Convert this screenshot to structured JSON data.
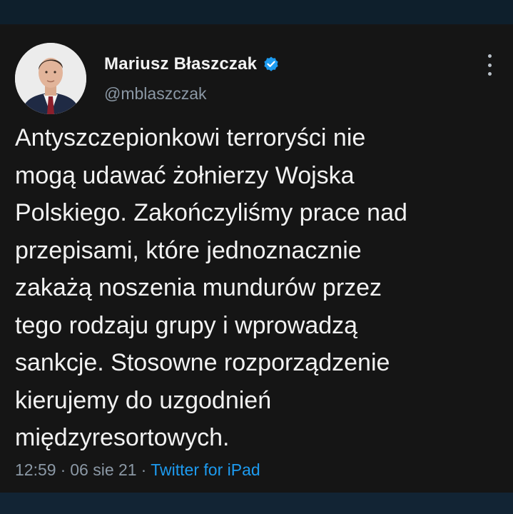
{
  "author": {
    "display_name": "Mariusz Błaszczak",
    "handle": "@mblaszczak",
    "verified_icon": "verified-badge-icon",
    "avatar_icon": "avatar-photo"
  },
  "tweet": {
    "lines": [
      "Antyszczepionkowi terroryści nie",
      "mogą udawać żołnierzy Wojska",
      "Polskiego. Zakończyliśmy prace nad",
      "przepisami, które jednoznacznie",
      "zakażą noszenia mundurów przez",
      "tego rodzaju grupy i wprowadzą",
      "sankcje. Stosowne rozporządzenie",
      "kierujemy do uzgodnień",
      "międzyresortowych."
    ]
  },
  "meta": {
    "time": "12:59",
    "separator": "·",
    "date": "06 sie 21",
    "source": "Twitter for iPad"
  },
  "colors": {
    "background": "#151515",
    "text": "#f2f2f2",
    "secondary": "#8b98a5",
    "accent": "#1d9bf0"
  },
  "icons": {
    "more": "more-options-icon"
  }
}
